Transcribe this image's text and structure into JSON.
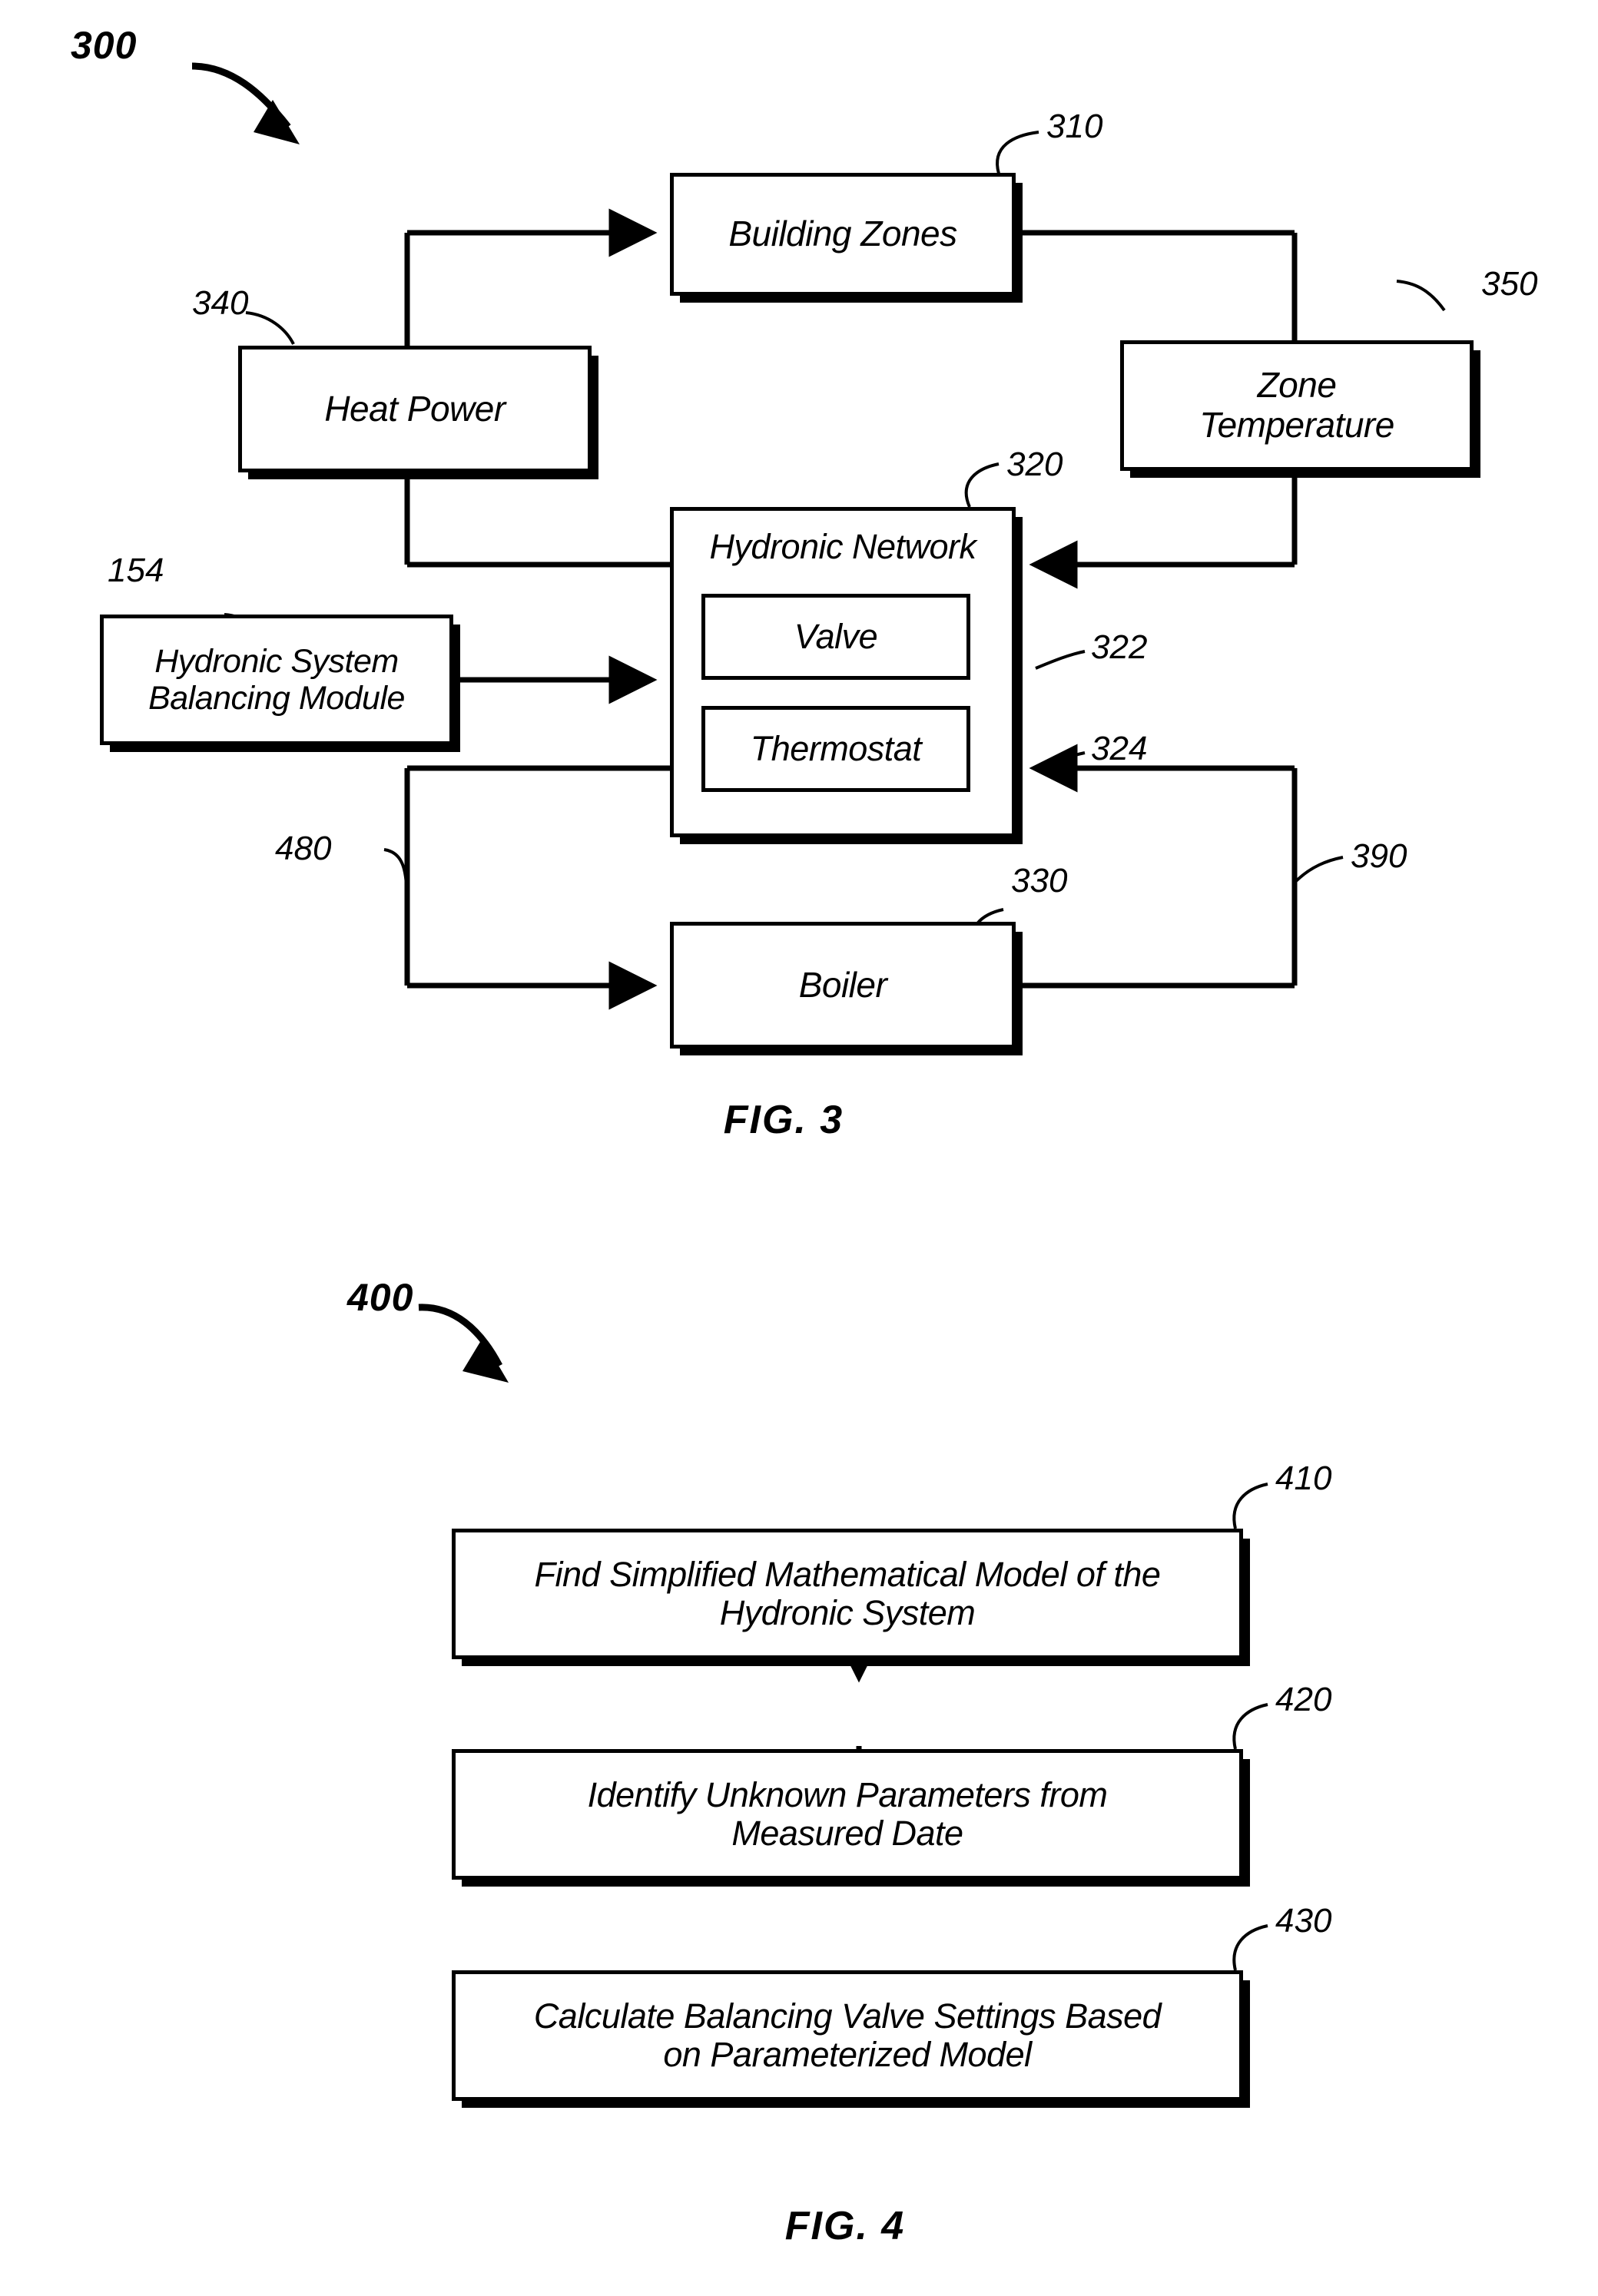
{
  "figure3": {
    "figure_number": "300",
    "caption": "FIG. 3",
    "boxes": {
      "building_zones": {
        "label": "Building Zones",
        "ref": "310"
      },
      "heat_power": {
        "label": "Heat Power",
        "ref": "340"
      },
      "zone_temperature": {
        "label_line1": "Zone",
        "label_line2": "Temperature",
        "ref": "350"
      },
      "hydronic_network": {
        "label": "Hydronic Network",
        "ref": "320"
      },
      "valve": {
        "label": "Valve",
        "ref": "322"
      },
      "thermostat": {
        "label": "Thermostat",
        "ref": "324"
      },
      "balancing_module": {
        "label_line1": "Hydronic System",
        "label_line2": "Balancing Module",
        "ref": "154"
      },
      "boiler": {
        "label": "Boiler",
        "ref": "330"
      }
    },
    "connection_refs": {
      "left_feedback": "480",
      "right_feedback": "390"
    }
  },
  "figure4": {
    "figure_number": "400",
    "caption": "FIG. 4",
    "steps": [
      {
        "ref": "410",
        "line1": "Find Simplified Mathematical Model of the",
        "line2": "Hydronic System"
      },
      {
        "ref": "420",
        "line1": "Identify Unknown Parameters from",
        "line2": "Measured Date"
      },
      {
        "ref": "430",
        "line1": "Calculate Balancing Valve Settings Based",
        "line2": "on Parameterized Model"
      }
    ]
  },
  "colors": {
    "ink": "#000000",
    "paper": "#ffffff"
  }
}
